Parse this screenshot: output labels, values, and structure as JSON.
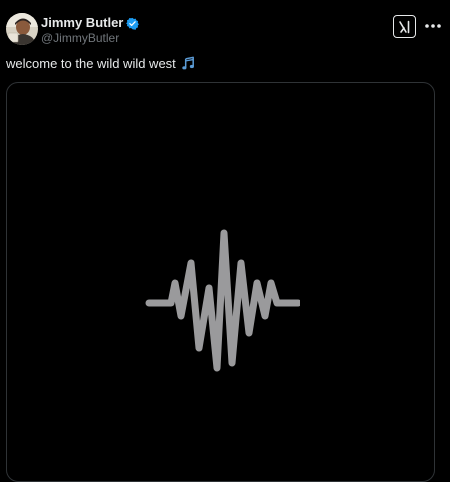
{
  "tweet": {
    "author": {
      "display_name": "Jimmy Butler",
      "handle": "@JimmyButler",
      "verified": true,
      "avatar_icon": "avatar-photo"
    },
    "text": "welcome to the wild wild west",
    "text_emoji": "music-notes-icon",
    "media": {
      "type": "audio",
      "icon": "waveform-icon"
    }
  },
  "header_actions": {
    "grok_icon": "grok-icon",
    "more_icon": "more-options-icon"
  },
  "colors": {
    "background": "#000000",
    "text_primary": "#e7e9ea",
    "text_secondary": "#71767b",
    "verified_blue": "#1d9bf0",
    "card_border": "#2f3336",
    "waveform_gray": "#9a9a9c",
    "emoji_blue": "#5b9bd5"
  }
}
